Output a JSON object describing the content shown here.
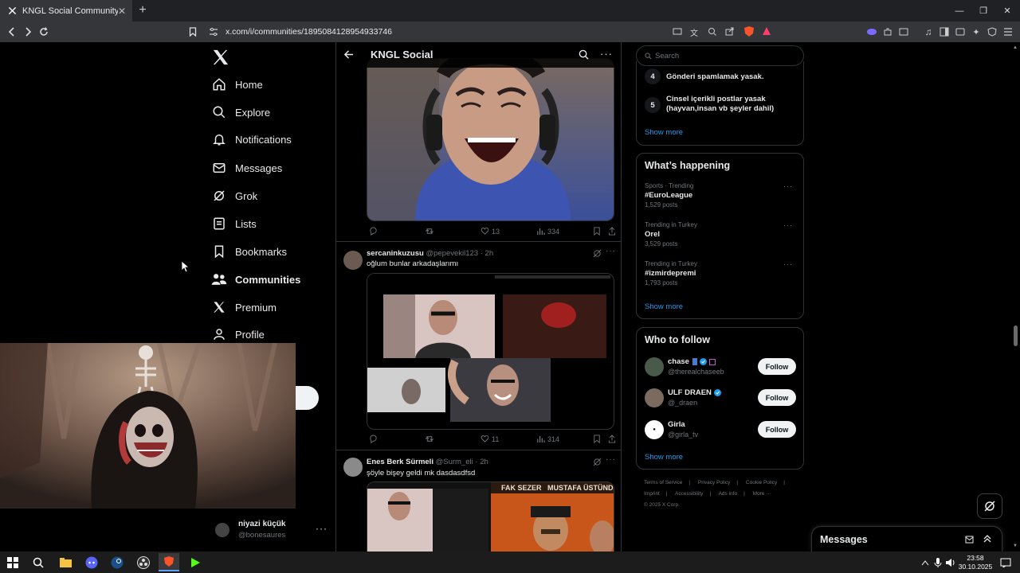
{
  "browser": {
    "tab_title": "KNGL Social Community / X",
    "url": "x.com/i/communities/1895084128954933746"
  },
  "nav": {
    "items": [
      {
        "label": "Home",
        "icon": "home-icon"
      },
      {
        "label": "Explore",
        "icon": "search-icon"
      },
      {
        "label": "Notifications",
        "icon": "bell-icon"
      },
      {
        "label": "Messages",
        "icon": "mail-icon"
      },
      {
        "label": "Grok",
        "icon": "grok-icon"
      },
      {
        "label": "Lists",
        "icon": "list-icon"
      },
      {
        "label": "Bookmarks",
        "icon": "bookmark-icon"
      },
      {
        "label": "Communities",
        "icon": "communities-icon"
      },
      {
        "label": "Premium",
        "icon": "x-logo-icon"
      },
      {
        "label": "Profile",
        "icon": "person-icon"
      }
    ],
    "account": {
      "name": "niyazi küçük",
      "handle": "@bonesaures"
    }
  },
  "header": {
    "title": "KNGL Social"
  },
  "posts": [
    {
      "replies": "",
      "reposts": "",
      "likes": "13",
      "views": "334"
    },
    {
      "author": "sercaninkuzusu",
      "handle": "@pepevekil123",
      "time": "· 2h",
      "text": "oğlum bunlar arkadaşlarımı",
      "replies": "",
      "reposts": "",
      "likes": "11",
      "views": "314"
    },
    {
      "author": "Enes Berk Sürmeli",
      "handle": "@Surm_eli",
      "time": "· 2h",
      "text": "şöyle bişey geldi mk dasdasdfsd"
    }
  ],
  "poster_text": {
    "left": "FAK SEZER",
    "right": "MUSTAFA ÜSTÜNDA"
  },
  "sidebar": {
    "search_placeholder": "Search",
    "rules": [
      {
        "num": "4",
        "text": "Gönderi spamlamak yasak."
      },
      {
        "num": "5",
        "text": "Cinsel içerikli postlar yasak (hayvan,insan vb şeyler dahil)"
      }
    ],
    "rules_show_more": "Show more",
    "happening_title": "What’s happening",
    "trends": [
      {
        "category": "Sports · Trending",
        "name": "#EuroLeague",
        "count": "1,529 posts"
      },
      {
        "category": "Trending in Turkey",
        "name": "Orel",
        "count": "3,529 posts"
      },
      {
        "category": "Trending in Turkey",
        "name": "#izmirdepremi",
        "count": "1,793 posts"
      }
    ],
    "trends_show_more": "Show more",
    "follow_title": "Who to follow",
    "follow": [
      {
        "name": "chase",
        "handle": "@therealchaseeb",
        "button": "Follow"
      },
      {
        "name": "ULF DRAEN",
        "handle": "@_draen",
        "button": "Follow"
      },
      {
        "name": "Girla",
        "handle": "@girla_tv",
        "button": "Follow"
      }
    ],
    "follow_show_more": "Show more",
    "footer_links": [
      "Terms of Service",
      "|",
      "Privacy Policy",
      "|",
      "Cookie Policy",
      "|",
      "Imprint",
      "|",
      "Accessibility",
      "|",
      "Ads info",
      "|",
      "More ···"
    ],
    "copyright": "© 2025 X Corp."
  },
  "messages_drawer": {
    "title": "Messages"
  },
  "taskbar": {
    "time": "23:58",
    "date": "30.10.2025"
  },
  "colors": {
    "accent": "#1d9bf0",
    "border": "#2f3336",
    "muted": "#71767b"
  }
}
